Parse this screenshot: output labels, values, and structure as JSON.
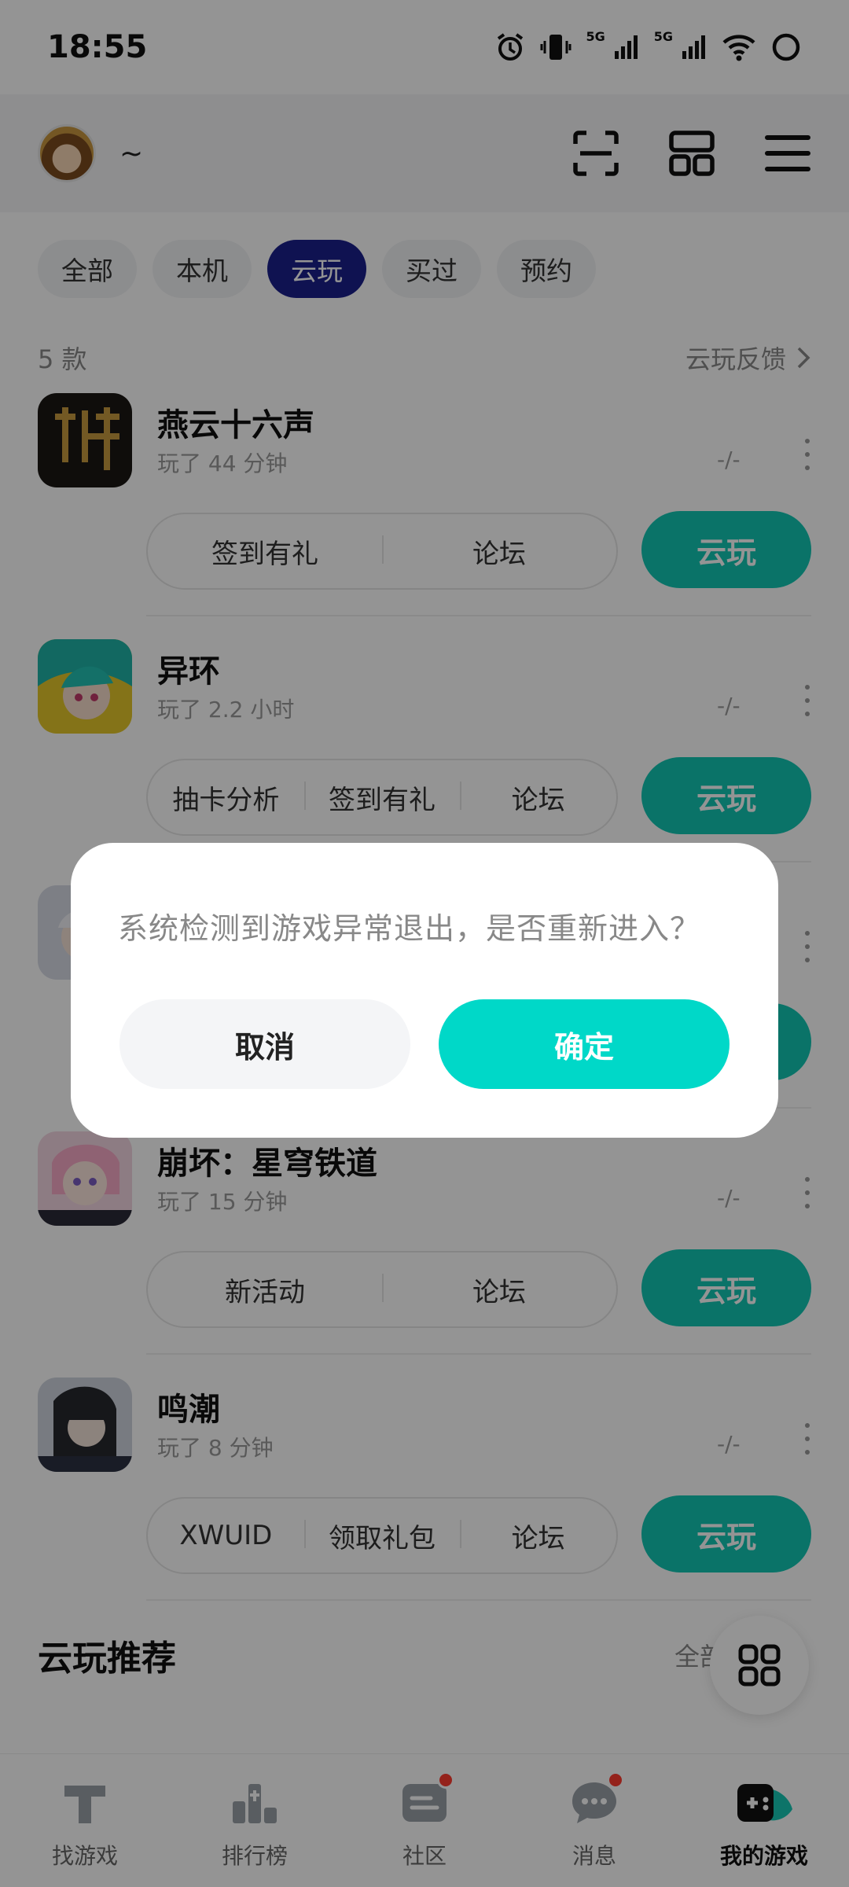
{
  "status_bar": {
    "time": "18:55",
    "net1": "5G",
    "net2": "5G",
    "icons": [
      "alarm-icon",
      "vibrate-icon",
      "signal-icon",
      "signal-icon",
      "wifi-icon",
      "battery-ring-icon"
    ]
  },
  "header": {
    "user_name": "~",
    "icons": [
      "scan-icon",
      "grid-layout-icon",
      "menu-icon"
    ]
  },
  "filters": {
    "items": [
      "全部",
      "本机",
      "云玩",
      "买过",
      "预约"
    ],
    "active": "云玩"
  },
  "list": {
    "count_label": "5 款",
    "feedback_label": "云玩反馈"
  },
  "games": [
    {
      "title": "燕云十六声",
      "played": "玩了 44 分钟",
      "score": "-/-",
      "actions": [
        "签到有礼",
        "论坛"
      ],
      "play_label": "云玩"
    },
    {
      "title": "异环",
      "played": "玩了 2.2 小时",
      "score": "-/-",
      "actions": [
        "抽卡分析",
        "签到有礼",
        "论坛"
      ],
      "play_label": "云玩"
    },
    {
      "title": "",
      "played": "",
      "score": "",
      "actions": [],
      "play_label": ""
    },
    {
      "title": "崩坏：星穹铁道",
      "played": "玩了 15 分钟",
      "score": "-/-",
      "actions": [
        "新活动",
        "论坛"
      ],
      "play_label": "云玩"
    },
    {
      "title": "鸣潮",
      "played": "玩了 8 分钟",
      "score": "-/-",
      "actions": [
        "XWUID",
        "领取礼包",
        "论坛"
      ],
      "play_label": "云玩"
    }
  ],
  "recommend": {
    "title": "云玩推荐",
    "all_label": "全部"
  },
  "bottom_nav": {
    "items": [
      {
        "label": "找游戏",
        "icon": "find-game-icon",
        "badge": false
      },
      {
        "label": "排行榜",
        "icon": "ranking-icon",
        "badge": false
      },
      {
        "label": "社区",
        "icon": "community-icon",
        "badge": true
      },
      {
        "label": "消息",
        "icon": "message-icon",
        "badge": true
      },
      {
        "label": "我的游戏",
        "icon": "my-games-icon",
        "badge": false
      }
    ],
    "active": "我的游戏"
  },
  "dialog": {
    "message": "系统检测到游戏异常退出，是否重新进入？",
    "cancel_label": "取消",
    "confirm_label": "确定"
  },
  "colors": {
    "accent_teal": "#12c7b4",
    "dialog_confirm": "#00d8c8",
    "active_chip": "#1a1f8c",
    "badge_red": "#ff3b30"
  }
}
